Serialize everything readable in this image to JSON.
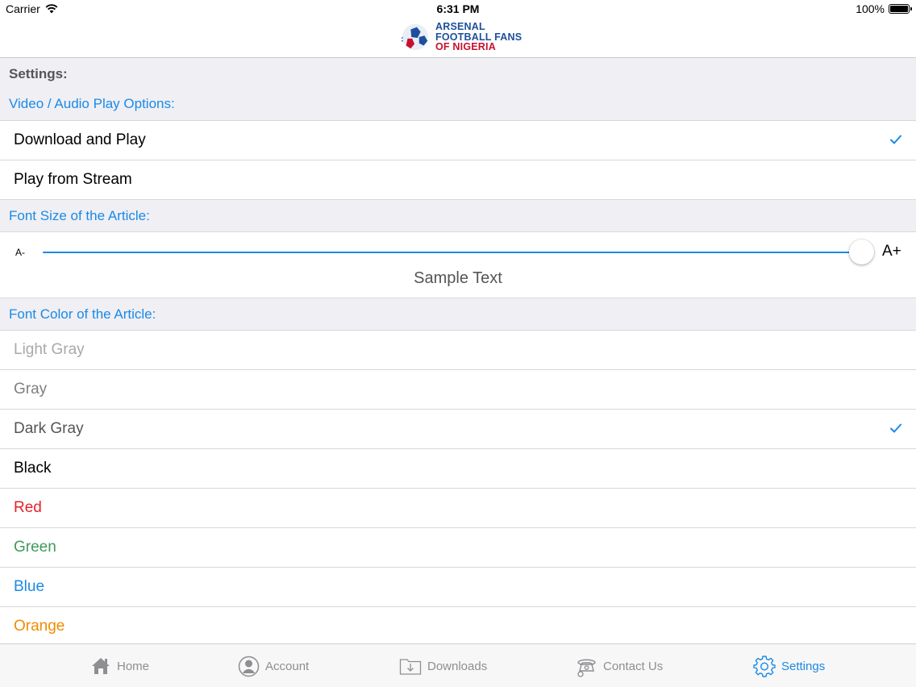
{
  "status_bar": {
    "carrier": "Carrier",
    "time": "6:31 PM",
    "battery": "100%"
  },
  "logo": {
    "line1": "ARSENAL",
    "line2": "FOOTBALL FANS",
    "line3": "OF NIGERIA"
  },
  "settings": {
    "title": "Settings:",
    "play_options": {
      "header": "Video / Audio Play Options:",
      "items": [
        {
          "label": "Download and Play",
          "selected": true
        },
        {
          "label": "Play from Stream",
          "selected": false
        }
      ]
    },
    "font_size": {
      "header": "Font Size of the Article:",
      "min_label": "A-",
      "max_label": "A+",
      "value": 1.0,
      "sample": "Sample Text"
    },
    "font_color": {
      "header": "Font Color of the Article:",
      "items": [
        {
          "label": "Light Gray",
          "color": "#a9a9a9",
          "selected": false
        },
        {
          "label": "Gray",
          "color": "#808080",
          "selected": false
        },
        {
          "label": "Dark Gray",
          "color": "#555555",
          "selected": true
        },
        {
          "label": "Black",
          "color": "#000000",
          "selected": false
        },
        {
          "label": "Red",
          "color": "#e8202a",
          "selected": false
        },
        {
          "label": "Green",
          "color": "#3e9a5a",
          "selected": false
        },
        {
          "label": "Blue",
          "color": "#1a8ae6",
          "selected": false
        },
        {
          "label": "Orange",
          "color": "#f08c00",
          "selected": false
        }
      ]
    }
  },
  "tabs": [
    {
      "label": "Home",
      "icon": "home-icon",
      "active": false
    },
    {
      "label": "Account",
      "icon": "account-icon",
      "active": false
    },
    {
      "label": "Downloads",
      "icon": "downloads-icon",
      "active": false
    },
    {
      "label": "Contact Us",
      "icon": "contact-icon",
      "active": false
    },
    {
      "label": "Settings",
      "icon": "gear-icon",
      "active": true
    }
  ],
  "colors": {
    "accent": "#1a8ae6",
    "group_background": "#efeff4",
    "tab_inactive": "#8e8e93"
  }
}
